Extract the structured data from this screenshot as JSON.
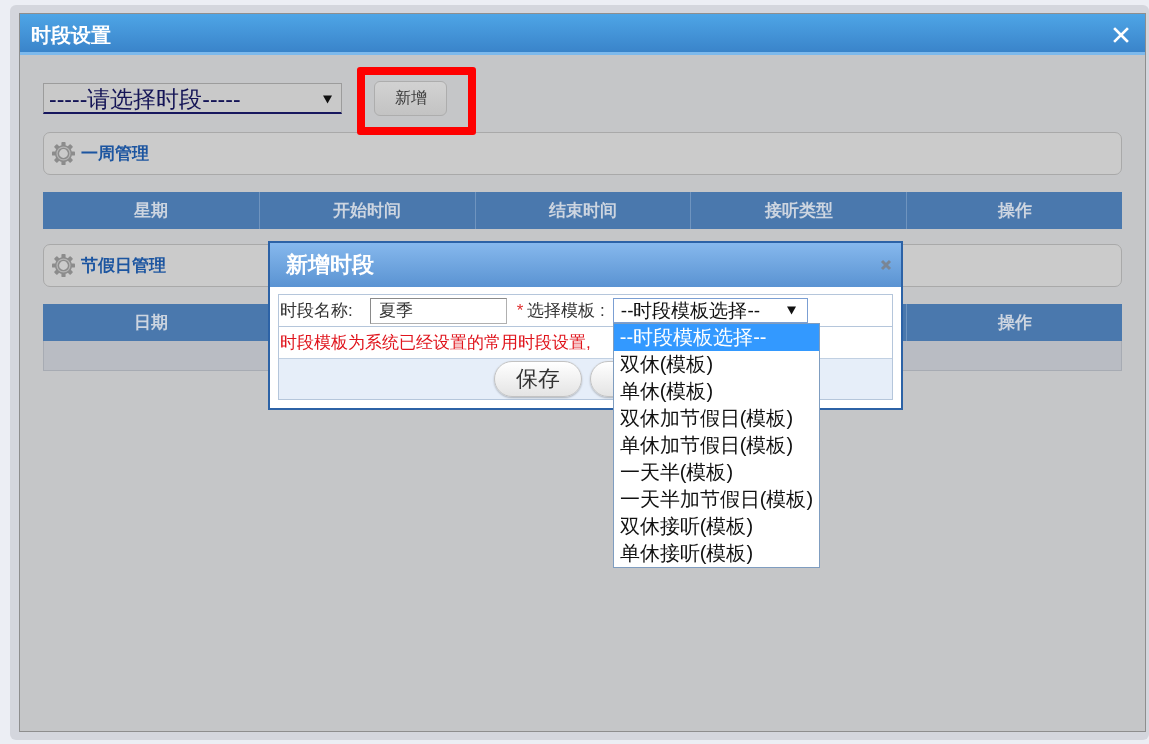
{
  "window": {
    "title": "时段设置"
  },
  "toolbar": {
    "period_select": {
      "value": "-----请选择时段-----"
    },
    "add_button": {
      "label": "新增",
      "highlighted": true
    }
  },
  "sections": [
    {
      "title": "一周管理",
      "table": {
        "columns": [
          "星期",
          "开始时间",
          "结束时间",
          "接听类型",
          "操作"
        ],
        "empty_row": false
      }
    },
    {
      "title": "节假日管理",
      "table": {
        "columns": [
          "日期",
          "操作"
        ],
        "empty_row": true
      }
    }
  ],
  "dialog": {
    "title": "新增时段",
    "name_field": {
      "label": "时段名称:",
      "value": "夏季"
    },
    "template_field": {
      "required_mark": "*",
      "label": "选择模板 :",
      "value": "--时段模板选择--",
      "expanded": true,
      "options": [
        {
          "label": "--时段模板选择--",
          "selected": true
        },
        {
          "label": "双休(模板)",
          "selected": false
        },
        {
          "label": "单休(模板)",
          "selected": false
        },
        {
          "label": "双休加节假日(模板)",
          "selected": false
        },
        {
          "label": "单休加节假日(模板)",
          "selected": false
        },
        {
          "label": "一天半(模板)",
          "selected": false
        },
        {
          "label": "一天半加节假日(模板)",
          "selected": false
        },
        {
          "label": "双休接听(模板)",
          "selected": false
        },
        {
          "label": "单休接听(模板)",
          "selected": false
        }
      ]
    },
    "hint": "时段模板为系统已经设置的常用时段设置,",
    "buttons": [
      {
        "kind": "text",
        "label": "保存"
      },
      {
        "kind": "blank"
      }
    ]
  }
}
